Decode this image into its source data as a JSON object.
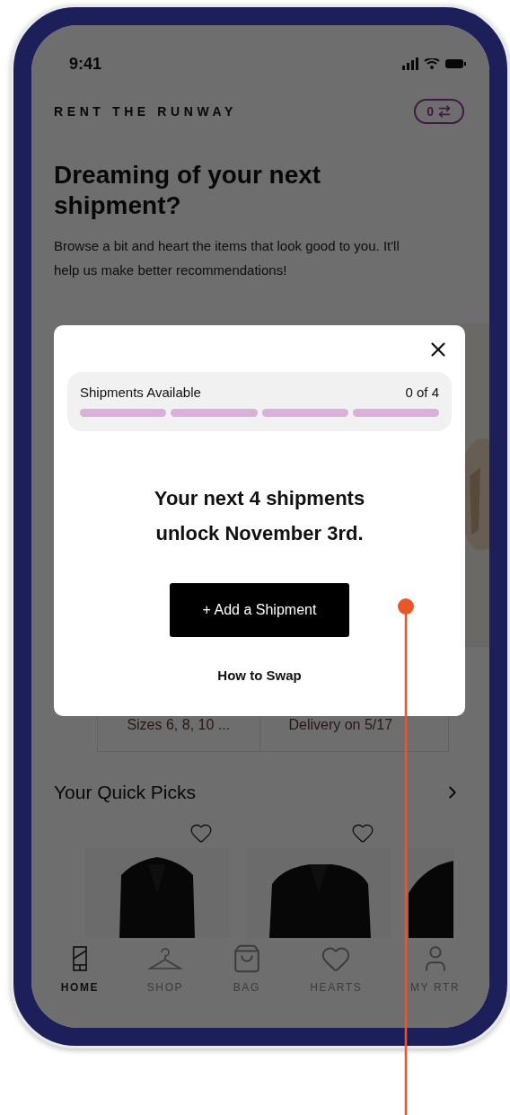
{
  "status_bar": {
    "time": "9:41"
  },
  "header": {
    "brand": "RENT THE RUNWAY",
    "swap_count": "0"
  },
  "intro": {
    "title": "Dreaming of your next shipment?",
    "text": "Browse a bit and heart the items that look good to you. It'll help us make better recommendations!"
  },
  "plan_details": [
    "Sizes 6, 8, 10 ...",
    "Delivery on 5/17"
  ],
  "quick_picks": {
    "title": "Your Quick Picks"
  },
  "tab_bar": [
    {
      "label": "HOME",
      "selected": true
    },
    {
      "label": "SHOP",
      "selected": false
    },
    {
      "label": "BAG",
      "selected": false
    },
    {
      "label": "HEARTS",
      "selected": false
    },
    {
      "label": "MY RTR",
      "selected": false
    }
  ],
  "modal": {
    "meter": {
      "label": "Shipments Available",
      "reading": "0 of 4",
      "segments": [
        {
          "filled": false
        },
        {
          "filled": false
        },
        {
          "filled": false
        },
        {
          "filled": false
        }
      ]
    },
    "message": "Your next 4 shipments unlock November 3rd.",
    "primary_button": "+ Add a Shipment",
    "link": "How to Swap"
  }
}
